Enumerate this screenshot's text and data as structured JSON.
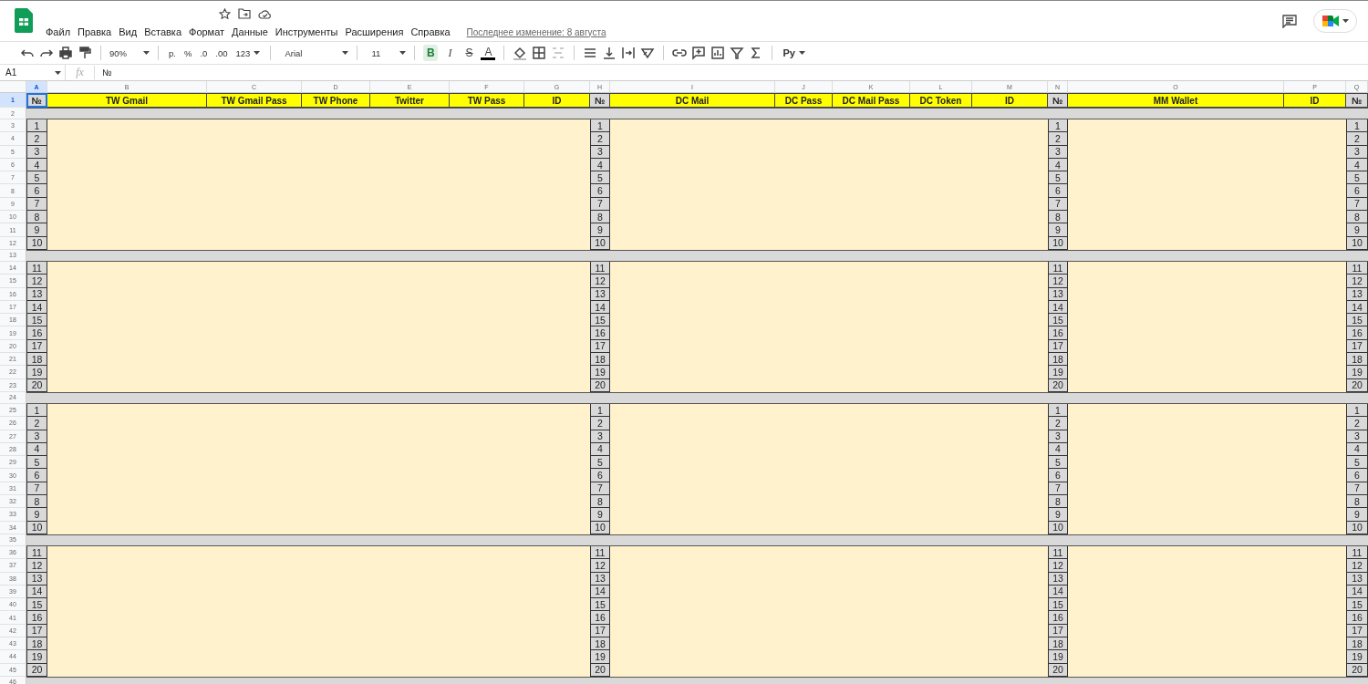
{
  "menu_bar": {
    "items": [
      "Файл",
      "Правка",
      "Вид",
      "Вставка",
      "Формат",
      "Данные",
      "Инструменты",
      "Расширения",
      "Справка"
    ],
    "last_edit": "Последнее изменение: 8 августа"
  },
  "toolbar": {
    "zoom": "90%",
    "currency": "р.",
    "percent": "%",
    "decrease_decimal": ".0",
    "increase_decimal": ".00",
    "number_format": "123",
    "font": "Arial",
    "font_size": "11",
    "bold": {
      "label": "B",
      "on": true
    },
    "italic": "I",
    "strikethrough": "S",
    "text_color": "A",
    "input_tools": "Ру"
  },
  "formula_bar": {
    "name_box": "A1",
    "fx": "fx",
    "value": "№"
  },
  "sheet": {
    "columns": [
      {
        "label": "A",
        "selected": true
      },
      {
        "label": "B",
        "selected": false
      },
      {
        "label": "C",
        "selected": false
      },
      {
        "label": "D",
        "selected": false
      },
      {
        "label": "E",
        "selected": false
      },
      {
        "label": "F",
        "selected": false
      },
      {
        "label": "G",
        "selected": false
      },
      {
        "label": "H",
        "selected": false
      },
      {
        "label": "I",
        "selected": false
      },
      {
        "label": "J",
        "selected": false
      },
      {
        "label": "K",
        "selected": false
      },
      {
        "label": "L",
        "selected": false
      },
      {
        "label": "M",
        "selected": false
      },
      {
        "label": "N",
        "selected": false
      },
      {
        "label": "O",
        "selected": false
      },
      {
        "label": "P",
        "selected": false
      },
      {
        "label": "Q",
        "selected": false
      }
    ],
    "rows": [
      {
        "label": "1",
        "kind": "header",
        "selected": true,
        "cells": [
          {
            "kind": "number",
            "text": "№",
            "selected": true
          },
          {
            "kind": "field",
            "text": "TW Gmail",
            "selected": false
          },
          {
            "kind": "field",
            "text": "TW Gmail Pass",
            "selected": false
          },
          {
            "kind": "field",
            "text": "TW Phone",
            "selected": false
          },
          {
            "kind": "field",
            "text": "Twitter",
            "selected": false
          },
          {
            "kind": "field",
            "text": "TW Pass",
            "selected": false
          },
          {
            "kind": "field",
            "text": "ID",
            "selected": false
          },
          {
            "kind": "number",
            "text": "№",
            "selected": false
          },
          {
            "kind": "field",
            "text": "DC Mail",
            "selected": false
          },
          {
            "kind": "field",
            "text": "DC Pass",
            "selected": false
          },
          {
            "kind": "field",
            "text": "DC Mail Pass",
            "selected": false
          },
          {
            "kind": "field",
            "text": "DC Token",
            "selected": false
          },
          {
            "kind": "field",
            "text": "ID",
            "selected": false
          },
          {
            "kind": "number",
            "text": "№",
            "selected": false
          },
          {
            "kind": "field",
            "text": "MM Wallet",
            "selected": false
          },
          {
            "kind": "field",
            "text": "ID",
            "selected": false
          },
          {
            "kind": "number",
            "text": "№",
            "selected": false
          }
        ]
      },
      {
        "label": "2",
        "kind": "separator",
        "selected": false
      },
      {
        "label": "3",
        "kind": "data",
        "selected": false,
        "numbers": [
          "1",
          "1",
          "1",
          "1"
        ]
      },
      {
        "label": "4",
        "kind": "data",
        "selected": false,
        "numbers": [
          "2",
          "2",
          "2",
          "2"
        ]
      },
      {
        "label": "5",
        "kind": "data",
        "selected": false,
        "numbers": [
          "3",
          "3",
          "3",
          "3"
        ]
      },
      {
        "label": "6",
        "kind": "data",
        "selected": false,
        "numbers": [
          "4",
          "4",
          "4",
          "4"
        ]
      },
      {
        "label": "7",
        "kind": "data",
        "selected": false,
        "numbers": [
          "5",
          "5",
          "5",
          "5"
        ]
      },
      {
        "label": "8",
        "kind": "data",
        "selected": false,
        "numbers": [
          "6",
          "6",
          "6",
          "6"
        ]
      },
      {
        "label": "9",
        "kind": "data",
        "selected": false,
        "numbers": [
          "7",
          "7",
          "7",
          "7"
        ]
      },
      {
        "label": "10",
        "kind": "data",
        "selected": false,
        "numbers": [
          "8",
          "8",
          "8",
          "8"
        ]
      },
      {
        "label": "11",
        "kind": "data",
        "selected": false,
        "numbers": [
          "9",
          "9",
          "9",
          "9"
        ]
      },
      {
        "label": "12",
        "kind": "data",
        "selected": false,
        "numbers": [
          "10",
          "10",
          "10",
          "10"
        ]
      },
      {
        "label": "13",
        "kind": "separator",
        "selected": false
      },
      {
        "label": "14",
        "kind": "data",
        "selected": false,
        "numbers": [
          "11",
          "11",
          "11",
          "11"
        ]
      },
      {
        "label": "15",
        "kind": "data",
        "selected": false,
        "numbers": [
          "12",
          "12",
          "12",
          "12"
        ]
      },
      {
        "label": "16",
        "kind": "data",
        "selected": false,
        "numbers": [
          "13",
          "13",
          "13",
          "13"
        ]
      },
      {
        "label": "17",
        "kind": "data",
        "selected": false,
        "numbers": [
          "14",
          "14",
          "14",
          "14"
        ]
      },
      {
        "label": "18",
        "kind": "data",
        "selected": false,
        "numbers": [
          "15",
          "15",
          "15",
          "15"
        ]
      },
      {
        "label": "19",
        "kind": "data",
        "selected": false,
        "numbers": [
          "16",
          "16",
          "16",
          "16"
        ]
      },
      {
        "label": "20",
        "kind": "data",
        "selected": false,
        "numbers": [
          "17",
          "17",
          "17",
          "17"
        ]
      },
      {
        "label": "21",
        "kind": "data",
        "selected": false,
        "numbers": [
          "18",
          "18",
          "18",
          "18"
        ]
      },
      {
        "label": "22",
        "kind": "data",
        "selected": false,
        "numbers": [
          "19",
          "19",
          "19",
          "19"
        ]
      },
      {
        "label": "23",
        "kind": "data",
        "selected": false,
        "numbers": [
          "20",
          "20",
          "20",
          "20"
        ]
      },
      {
        "label": "24",
        "kind": "separator",
        "selected": false
      },
      {
        "label": "25",
        "kind": "data",
        "selected": false,
        "numbers": [
          "1",
          "1",
          "1",
          "1"
        ]
      },
      {
        "label": "26",
        "kind": "data",
        "selected": false,
        "numbers": [
          "2",
          "2",
          "2",
          "2"
        ]
      },
      {
        "label": "27",
        "kind": "data",
        "selected": false,
        "numbers": [
          "3",
          "3",
          "3",
          "3"
        ]
      },
      {
        "label": "28",
        "kind": "data",
        "selected": false,
        "numbers": [
          "4",
          "4",
          "4",
          "4"
        ]
      },
      {
        "label": "29",
        "kind": "data",
        "selected": false,
        "numbers": [
          "5",
          "5",
          "5",
          "5"
        ]
      },
      {
        "label": "30",
        "kind": "data",
        "selected": false,
        "numbers": [
          "6",
          "6",
          "6",
          "6"
        ]
      },
      {
        "label": "31",
        "kind": "data",
        "selected": false,
        "numbers": [
          "7",
          "7",
          "7",
          "7"
        ]
      },
      {
        "label": "32",
        "kind": "data",
        "selected": false,
        "numbers": [
          "8",
          "8",
          "8",
          "8"
        ]
      },
      {
        "label": "33",
        "kind": "data",
        "selected": false,
        "numbers": [
          "9",
          "9",
          "9",
          "9"
        ]
      },
      {
        "label": "34",
        "kind": "data",
        "selected": false,
        "numbers": [
          "10",
          "10",
          "10",
          "10"
        ]
      },
      {
        "label": "35",
        "kind": "separator",
        "selected": false
      },
      {
        "label": "36",
        "kind": "data",
        "selected": false,
        "numbers": [
          "11",
          "11",
          "11",
          "11"
        ]
      },
      {
        "label": "37",
        "kind": "data",
        "selected": false,
        "numbers": [
          "12",
          "12",
          "12",
          "12"
        ]
      },
      {
        "label": "38",
        "kind": "data",
        "selected": false,
        "numbers": [
          "13",
          "13",
          "13",
          "13"
        ]
      },
      {
        "label": "39",
        "kind": "data",
        "selected": false,
        "numbers": [
          "14",
          "14",
          "14",
          "14"
        ]
      },
      {
        "label": "40",
        "kind": "data",
        "selected": false,
        "numbers": [
          "15",
          "15",
          "15",
          "15"
        ]
      },
      {
        "label": "41",
        "kind": "data",
        "selected": false,
        "numbers": [
          "16",
          "16",
          "16",
          "16"
        ]
      },
      {
        "label": "42",
        "kind": "data",
        "selected": false,
        "numbers": [
          "17",
          "17",
          "17",
          "17"
        ]
      },
      {
        "label": "43",
        "kind": "data",
        "selected": false,
        "numbers": [
          "18",
          "18",
          "18",
          "18"
        ]
      },
      {
        "label": "44",
        "kind": "data",
        "selected": false,
        "numbers": [
          "19",
          "19",
          "19",
          "19"
        ]
      },
      {
        "label": "45",
        "kind": "data",
        "selected": false,
        "numbers": [
          "20",
          "20",
          "20",
          "20"
        ]
      },
      {
        "label": "46",
        "kind": "separator",
        "selected": false
      }
    ]
  }
}
